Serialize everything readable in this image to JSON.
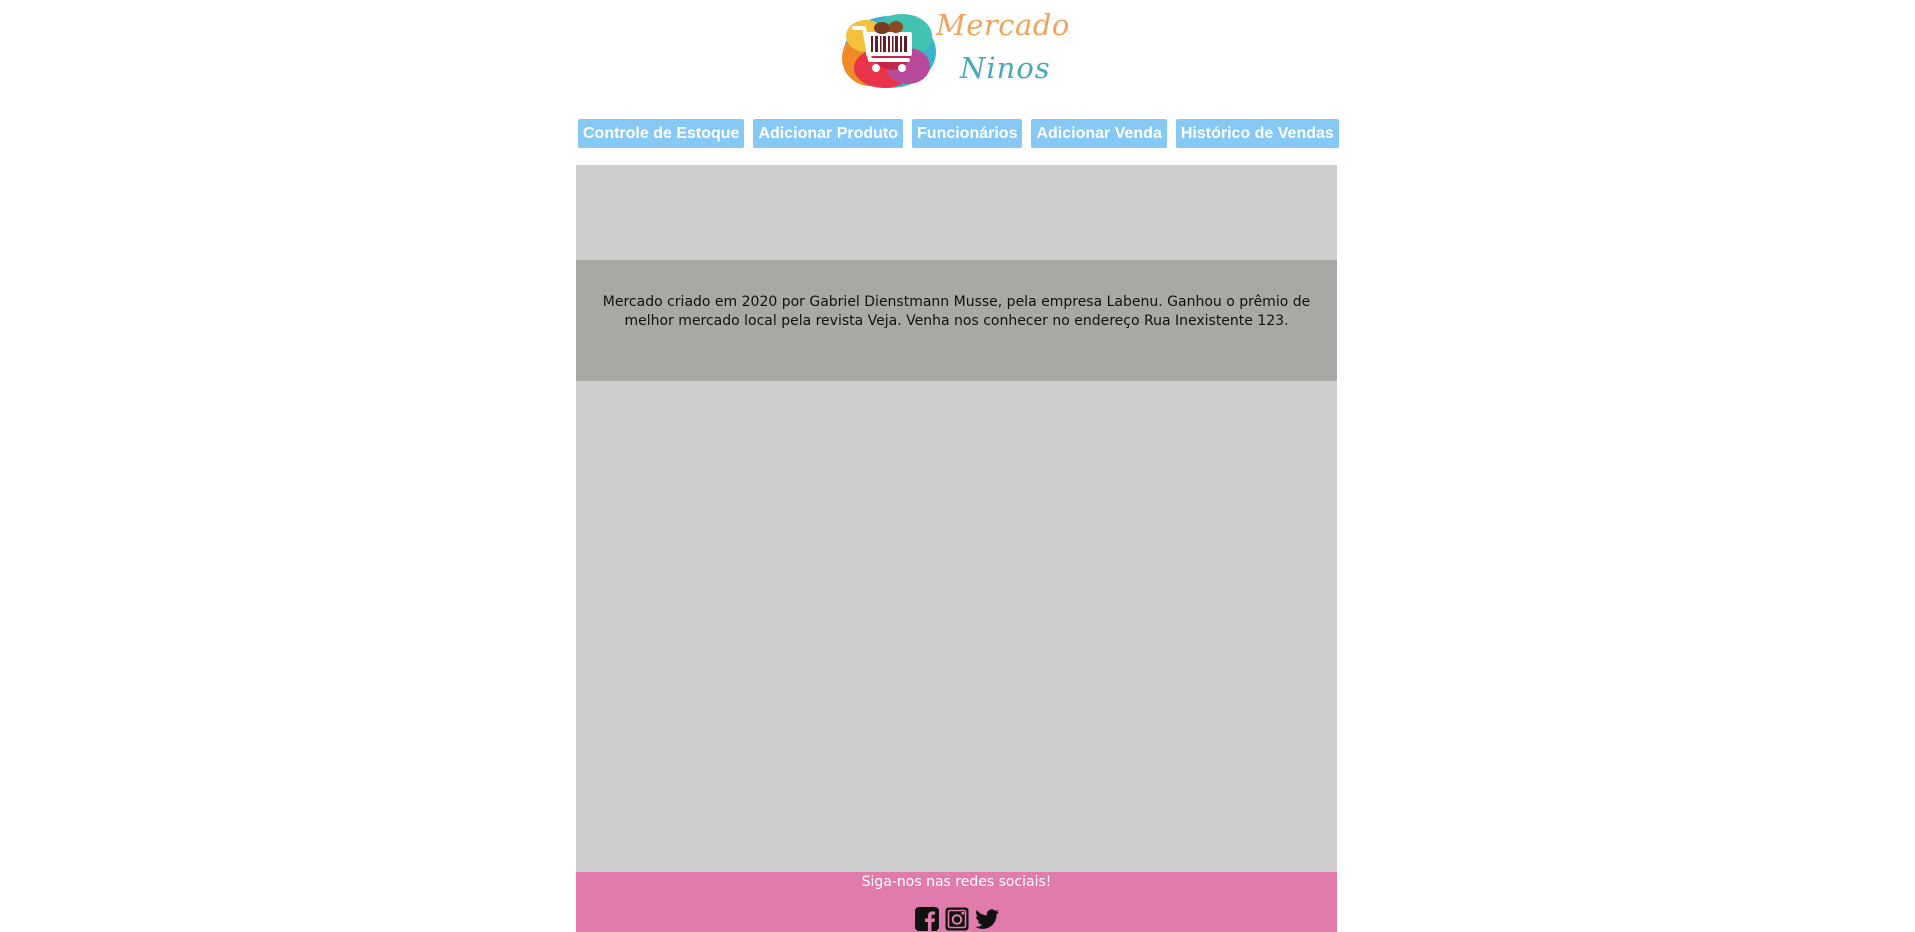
{
  "logo": {
    "word1": "Mercado",
    "word2": "Ninos",
    "icon": "shopping-cart-barcode-icon"
  },
  "nav": {
    "items": [
      {
        "label": "Controle de Estoque"
      },
      {
        "label": "Adicionar Produto"
      },
      {
        "label": "Funcionários"
      },
      {
        "label": "Adicionar Venda"
      },
      {
        "label": "Histórico de Vendas"
      }
    ]
  },
  "main": {
    "about_text": "Mercado criado em 2020 por Gabriel Dienstmann Musse, pela empresa Labenu. Ganhou o prêmio de melhor mercado local pela revista Veja. Venha nos conhecer no endereço Rua Inexistente 123."
  },
  "footer": {
    "text": "Siga-nos nas redes sociais!",
    "social": [
      {
        "icon": "facebook-icon"
      },
      {
        "icon": "instagram-icon"
      },
      {
        "icon": "twitter-icon"
      }
    ]
  },
  "colors": {
    "nav_button": "#86c9f5",
    "main_background": "#cecece",
    "about_background": "#a9a8a5",
    "footer_background": "#e07bab",
    "logo_word1": "#f2a35a",
    "logo_word2": "#4aa9b8"
  }
}
